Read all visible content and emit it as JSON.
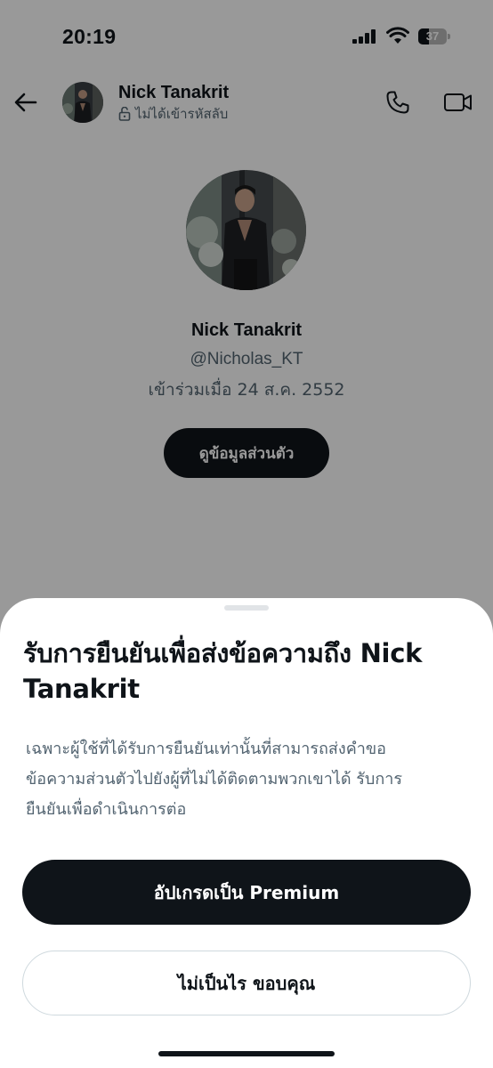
{
  "status_bar": {
    "time": "20:19",
    "battery_level": "37",
    "battery_fraction": 0.37
  },
  "header": {
    "name": "Nick Tanakrit",
    "subtitle": "ไม่ได้เข้ารหัสลับ",
    "icons": [
      "back-arrow-icon",
      "lock-icon",
      "phone-icon",
      "video-icon"
    ]
  },
  "profile": {
    "name": "Nick Tanakrit",
    "handle": "@Nicholas_KT",
    "joined": "เข้าร่วมเมื่อ 24 ส.ค. 2552",
    "view_profile_label": "ดูข้อมูลส่วนตัว"
  },
  "sheet": {
    "title_line1": "รับการยืนยันเพื่อส่งข้อความถึง Nick",
    "title_line2": "Tanakrit",
    "body_line1": "เฉพาะผู้ใช้ที่ได้รับการยืนยันเท่านั้นที่สามารถส่งคำขอ",
    "body_line2": "ข้อความส่วนตัวไปยังผู้ที่ไม่ได้ติดตามพวกเขาได้ รับการ",
    "body_line3": "ยืนยันเพื่อดำเนินการต่อ",
    "primary_label": "อัปเกรดเป็น Premium",
    "secondary_label": "ไม่เป็นไร ขอบคุณ"
  },
  "colors": {
    "text_primary": "#0f1419",
    "text_secondary": "#536471",
    "overlay": "rgba(0,0,0,0.40)",
    "button_border": "#cfd9de"
  }
}
